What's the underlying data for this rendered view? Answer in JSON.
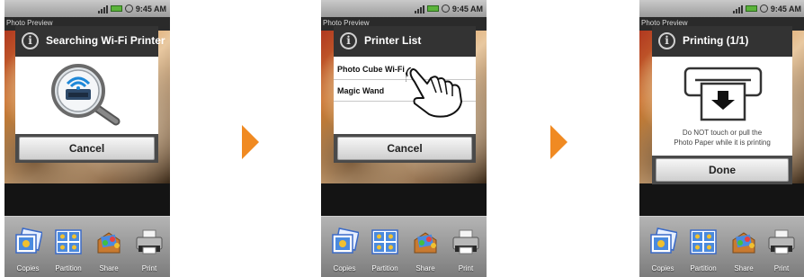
{
  "screens": [
    {
      "status_time": "9:45 AM",
      "app_title": "Photo Preview",
      "dialog_title": "Searching Wi-Fi Printer",
      "button": "Cancel",
      "toolbar": [
        "Copies",
        "Partition",
        "Share",
        "Print"
      ]
    },
    {
      "status_time": "9:45 AM",
      "app_title": "Photo Preview",
      "dialog_title": "Printer List",
      "printers": [
        "Photo Cube Wi-Fi",
        "Magic Wand"
      ],
      "button": "Cancel",
      "toolbar": [
        "Copies",
        "Partition",
        "Share",
        "Print"
      ]
    },
    {
      "status_time": "9:45 AM",
      "app_title": "Photo Preview",
      "dialog_title": "Printing (1/1)",
      "warning_line1": "Do NOT touch or pull the",
      "warning_line2": "Photo Paper while it is printing",
      "button": "Done",
      "toolbar": [
        "Copies",
        "Partition",
        "Share",
        "Print"
      ]
    }
  ],
  "colors": {
    "arrow": "#f08a22",
    "dialog_header": "#333333",
    "wifi_blue": "#1e88d8"
  }
}
